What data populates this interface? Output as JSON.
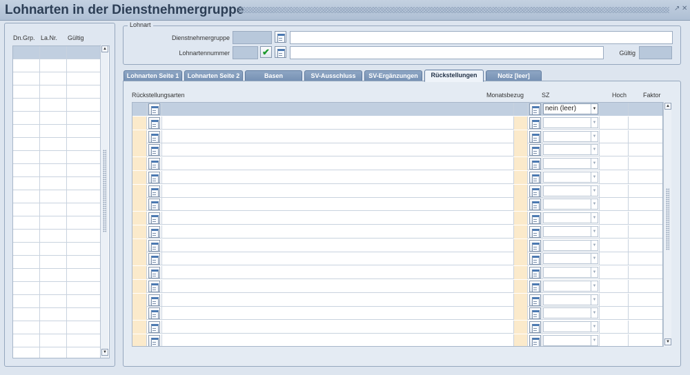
{
  "window": {
    "title": "Lohnarten in der Dienstnehmergruppe"
  },
  "left_list": {
    "columns": [
      "Dn.Grp.",
      "La.Nr.",
      "Gültig"
    ]
  },
  "lohnart": {
    "legend": "Lohnart",
    "dienstnehmergruppe_label": "Dienstnehmergruppe",
    "lohnartennummer_label": "Lohnartennummer",
    "gueltig_label": "Gültig"
  },
  "tabs": [
    {
      "label": "Lohnarten Seite 1",
      "active": false
    },
    {
      "label": "Lohnarten Seite 2",
      "active": false
    },
    {
      "label": "Basen",
      "active": false
    },
    {
      "label": "SV-Ausschluss",
      "active": false
    },
    {
      "label": "SV-Ergänzungen",
      "active": false
    },
    {
      "label": "Rückstellungen",
      "active": true
    },
    {
      "label": "Notiz [leer]",
      "active": false
    }
  ],
  "grid": {
    "columns": {
      "rueckstellungsarten": "Rückstellungsarten",
      "monatsbezug": "Monatsbezug",
      "sz": "SZ",
      "hoch": "Hoch",
      "faktor": "Faktor"
    },
    "first_row_sz": "nein (leer)"
  },
  "colors": {
    "title": "#2c3e55",
    "tab_bg": "#7f98b9",
    "highlight": "#fbeacb"
  }
}
